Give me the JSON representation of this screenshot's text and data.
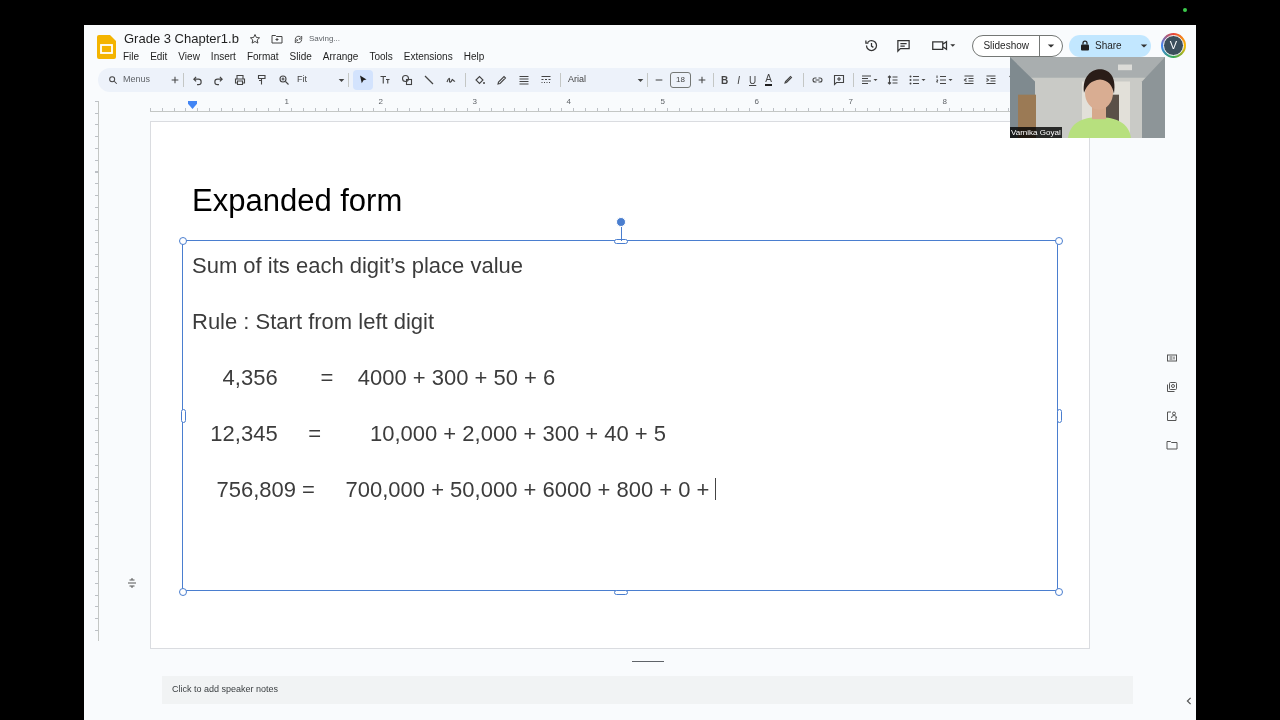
{
  "document": {
    "title": "Grade 3 Chapter1.b",
    "status": "Saving..."
  },
  "menu": [
    "File",
    "Edit",
    "View",
    "Insert",
    "Format",
    "Slide",
    "Arrange",
    "Tools",
    "Extensions",
    "Help"
  ],
  "header_buttons": {
    "slideshow": "Slideshow",
    "share": "Share",
    "avatar": "V"
  },
  "toolbar": {
    "search_placeholder": "Menus",
    "zoom": "Fit",
    "font": "Arial",
    "font_size": "18",
    "format_buttons": [
      "B",
      "I",
      "U",
      "A"
    ],
    "tools": [
      {
        "kind": "select",
        "selected": true
      },
      {
        "kind": "textbox",
        "selected": false
      },
      {
        "kind": "shape",
        "selected": false
      },
      {
        "kind": "line",
        "selected": false
      },
      {
        "kind": "scribble",
        "selected": false
      }
    ]
  },
  "ruler": [
    "1",
    "2",
    "3",
    "4",
    "5",
    "6",
    "7",
    "8"
  ],
  "slide": {
    "title": "Expanded form",
    "lines": [
      "Sum of its each digit’s place value",
      "Rule : Start from left digit",
      "     4,356       =    4000 + 300 + 50 + 6",
      "   12,345     =        10,000 + 2,000 + 300 + 40 + 5",
      "    756,809 =     700,000 + 50,000 + 6000 + 800 + 0 +"
    ],
    "editing": true
  },
  "video": {
    "name": "Varnika Goyal"
  },
  "speaker_notes": {
    "placeholder": "Click to add speaker notes"
  }
}
